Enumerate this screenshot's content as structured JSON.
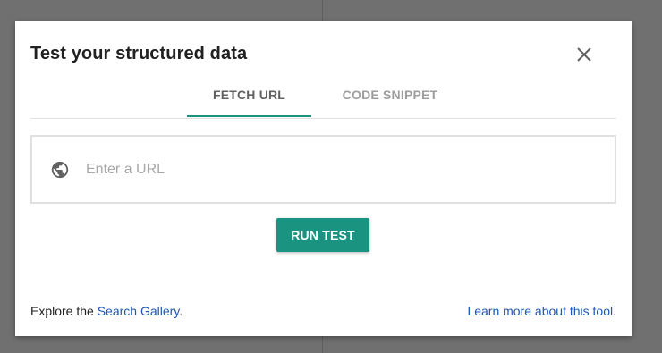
{
  "dialog": {
    "title": "Test your structured data",
    "close_icon": "close-icon"
  },
  "tabs": [
    {
      "label": "FETCH URL",
      "active": true
    },
    {
      "label": "CODE SNIPPET",
      "active": false
    }
  ],
  "url_field": {
    "icon": "globe-icon",
    "placeholder": "Enter a URL",
    "value": ""
  },
  "run_button": {
    "label": "RUN TEST"
  },
  "footer": {
    "explore_prefix": "Explore the ",
    "search_gallery_link": "Search Gallery",
    "explore_suffix": ".",
    "learn_more_link": "Learn more about this tool",
    "learn_more_suffix": "."
  },
  "colors": {
    "accent": "#1a9480",
    "link": "#1a57b8",
    "overlay": "#707070"
  }
}
